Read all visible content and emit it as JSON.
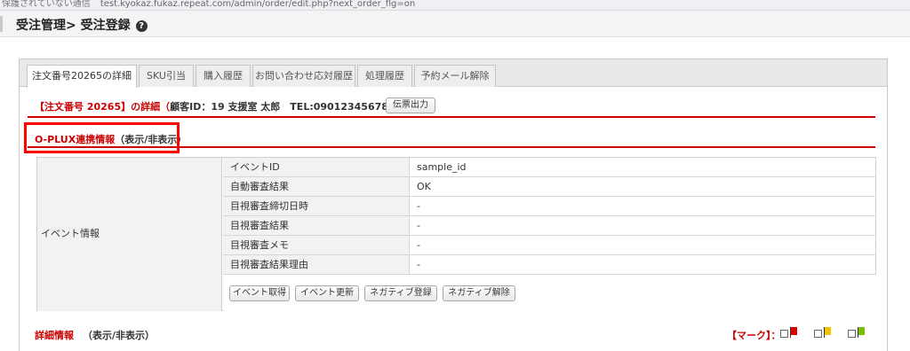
{
  "browser": {
    "security_text": "保護されていない通信",
    "url": "test.kyokaz.fukaz.repeat.com/admin/order/edit.php?next_order_flg=on"
  },
  "header": {
    "title": "受注管理> 受注登録",
    "help_icon": "question-circle-icon"
  },
  "tabs": [
    {
      "label": "注文番号20265の詳細",
      "active": true
    },
    {
      "label": "SKU引当"
    },
    {
      "label": "購入履歴"
    },
    {
      "label": "お問い合わせ応対履歴"
    },
    {
      "label": "処理履歴"
    },
    {
      "label": "予約メール解除"
    }
  ],
  "order_info": {
    "order_title": "【注文番号 20265】の詳細（",
    "customer": "顧客ID：19 支援室 太郎　TEL:09012345678",
    "close": "）",
    "print_button": "伝票出力"
  },
  "oplux": {
    "title": "O-PLUX連携情報",
    "toggle": "（表示/非表示）"
  },
  "event": {
    "label": "イベント情報",
    "rows": [
      {
        "key": "イベントID",
        "value": "sample_id"
      },
      {
        "key": "自動審査結果",
        "value": "OK"
      },
      {
        "key": "目視審査締切日時",
        "value": "-"
      },
      {
        "key": "目視審査結果",
        "value": "-"
      },
      {
        "key": "目視審査メモ",
        "value": "-"
      },
      {
        "key": "目視審査結果理由",
        "value": "-"
      }
    ],
    "buttons": [
      "イベント取得",
      "イベント更新",
      "ネガティブ登録",
      "ネガティブ解除"
    ]
  },
  "details": {
    "title": "詳細情報",
    "toggle": "（表示/非表示）",
    "mark_label": "【マーク】："
  },
  "flags": [
    {
      "color": "#e00000"
    },
    {
      "color": "#f2c200"
    },
    {
      "color": "#7ac000"
    }
  ]
}
